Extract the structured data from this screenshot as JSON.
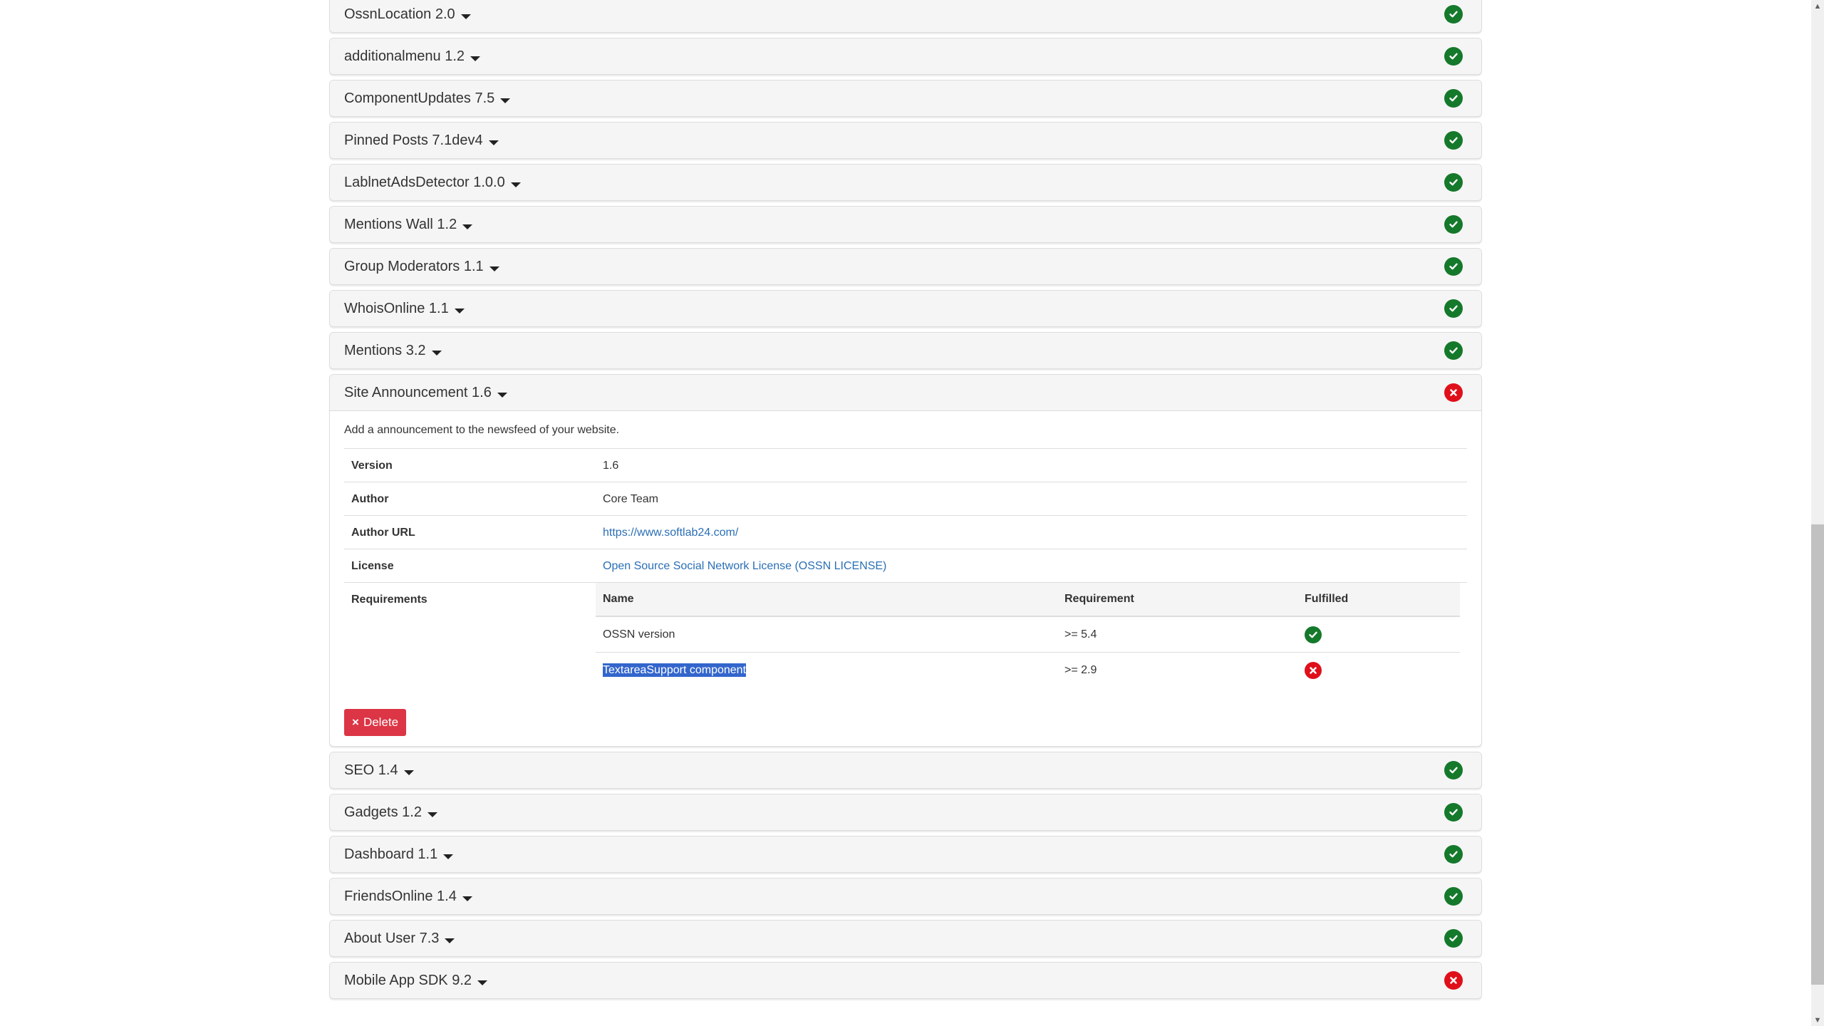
{
  "components": [
    {
      "name": "OssnLocation 2.0",
      "status": "ok"
    },
    {
      "name": "additionalmenu 1.2",
      "status": "ok"
    },
    {
      "name": "ComponentUpdates 7.5",
      "status": "ok"
    },
    {
      "name": "Pinned Posts 7.1dev4",
      "status": "ok"
    },
    {
      "name": "LablnetAdsDetector 1.0.0",
      "status": "ok"
    },
    {
      "name": "Mentions Wall 1.2",
      "status": "ok"
    },
    {
      "name": "Group Moderators 1.1",
      "status": "ok"
    },
    {
      "name": "WhoisOnline 1.1",
      "status": "ok"
    },
    {
      "name": "Mentions 3.2",
      "status": "ok"
    },
    {
      "name": "Site Announcement 1.6",
      "status": "fail",
      "expanded": true
    },
    {
      "name": "SEO 1.4",
      "status": "ok"
    },
    {
      "name": "Gadgets 1.2",
      "status": "ok"
    },
    {
      "name": "Dashboard 1.1",
      "status": "ok"
    },
    {
      "name": "FriendsOnline 1.4",
      "status": "ok"
    },
    {
      "name": "About User 7.3",
      "status": "ok"
    },
    {
      "name": "Mobile App SDK 9.2",
      "status": "fail"
    }
  ],
  "expanded": {
    "description": "Add a announcement to the newsfeed of your website.",
    "details": {
      "version_label": "Version",
      "version_value": "1.6",
      "author_label": "Author",
      "author_value": "Core Team",
      "author_url_label": "Author URL",
      "author_url_value": "https://www.softlab24.com/",
      "license_label": "License",
      "license_value": "Open Source Social Network License (OSSN LICENSE)",
      "requirements_label": "Requirements"
    },
    "requirements": {
      "headers": {
        "name": "Name",
        "requirement": "Requirement",
        "fulfilled": "Fulfilled"
      },
      "rows": [
        {
          "name": "OSSN version",
          "requirement": ">= 5.4",
          "fulfilled": true,
          "selected": false
        },
        {
          "name": "TextareaSupport component",
          "requirement": ">= 2.9",
          "fulfilled": false,
          "selected": true
        }
      ]
    },
    "delete_label": "Delete",
    "delete_icon": "×"
  },
  "colors": {
    "ok": "#15792b",
    "fail": "#e0101b",
    "delete_button": "#dc3545",
    "link": "#2a6fb5",
    "selection": "#3366cc"
  },
  "scrollbar": {
    "position_fraction": 0.84
  }
}
